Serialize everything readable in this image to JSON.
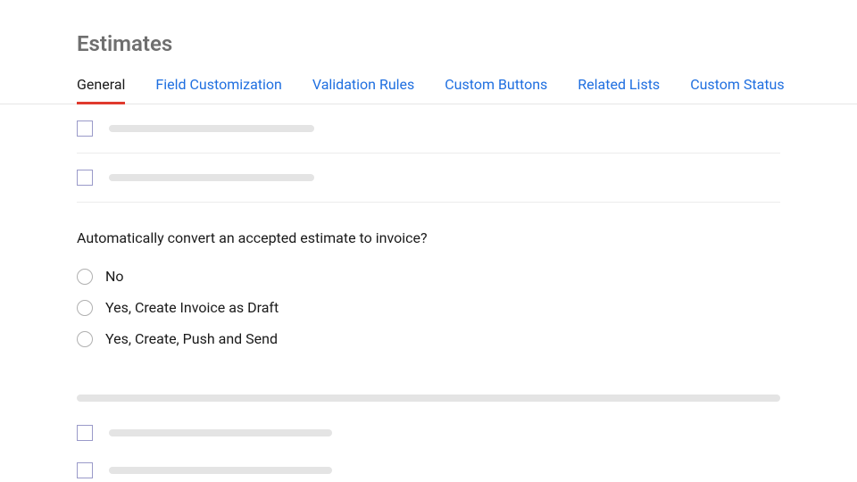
{
  "page": {
    "title": "Estimates"
  },
  "tabs": [
    {
      "label": "General",
      "active": true
    },
    {
      "label": "Field Customization",
      "active": false
    },
    {
      "label": "Validation Rules",
      "active": false
    },
    {
      "label": "Custom Buttons",
      "active": false
    },
    {
      "label": "Related Lists",
      "active": false
    },
    {
      "label": "Custom Status",
      "active": false
    }
  ],
  "question": {
    "prompt": "Automatically convert an accepted estimate to invoice?",
    "options": [
      {
        "label": "No"
      },
      {
        "label": "Yes, Create Invoice as Draft"
      },
      {
        "label": "Yes, Create, Push and Send"
      }
    ]
  }
}
